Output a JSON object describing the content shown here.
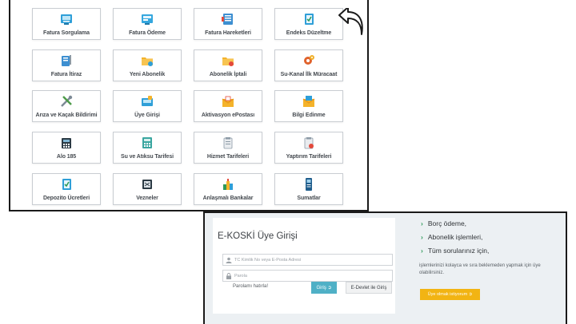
{
  "services": {
    "tiles": [
      {
        "label": "Fatura Sorgulama",
        "icon": "invoice-query-icon"
      },
      {
        "label": "Fatura Ödeme",
        "icon": "invoice-payment-icon"
      },
      {
        "label": "Fatura Hareketleri",
        "icon": "invoice-movements-icon"
      },
      {
        "label": "Endeks Düzeltme",
        "icon": "meter-correction-icon"
      },
      {
        "label": "Fatura İtiraz",
        "icon": "invoice-objection-icon"
      },
      {
        "label": "Yeni Abonelik",
        "icon": "new-subscription-icon"
      },
      {
        "label": "Abonelik İptali",
        "icon": "subscription-cancel-icon"
      },
      {
        "label": "Su-Kanal İlk Müracaat",
        "icon": "water-channel-application-icon"
      },
      {
        "label": "Arıza ve Kaçak Bildirimi",
        "icon": "fault-report-icon"
      },
      {
        "label": "Üye Girişi",
        "icon": "member-login-icon"
      },
      {
        "label": "Aktivasyon ePostası",
        "icon": "activation-email-icon"
      },
      {
        "label": "Bilgi Edinme",
        "icon": "information-request-icon"
      },
      {
        "label": "Alo 185",
        "icon": "phone-icon"
      },
      {
        "label": "Su ve Atıksu Tarifesi",
        "icon": "calculator-icon"
      },
      {
        "label": "Hizmet Tarifeleri",
        "icon": "service-tariffs-icon"
      },
      {
        "label": "Yaptırım Tarifeleri",
        "icon": "sanction-tariffs-icon"
      },
      {
        "label": "Depozito Ücretleri",
        "icon": "deposit-fees-icon"
      },
      {
        "label": "Vezneler",
        "icon": "cashier-icon"
      },
      {
        "label": "Anlaşmalı Bankalar",
        "icon": "contracted-banks-icon"
      },
      {
        "label": "Sumatlar",
        "icon": "sumatic-device-icon"
      }
    ]
  },
  "login": {
    "title": "E-KOSKİ Üye Girişi",
    "id_placeholder": "TC Kimlik No veya E-Posta Adresi",
    "id_value": "",
    "password_placeholder": "Parola",
    "password_value": "",
    "forgot_label": "Parolamı hatırla!",
    "login_button": "Giriş ➲",
    "edevlet_button": "E-Devlet ile Giriş",
    "benefits": [
      "Borç ödeme,",
      "Abonelik işlemleri,",
      "Tüm sorularınız için,"
    ],
    "description": "işlemlerinizi kolayca ve sıra beklemeden yapmak için üye olabilirsiniz.",
    "register_button": "Üye olmak istiyorum ➲"
  },
  "colors": {
    "accent_teal": "#4fb0c6",
    "accent_yellow": "#f2b413",
    "chevron_green": "#2e9a5a"
  }
}
